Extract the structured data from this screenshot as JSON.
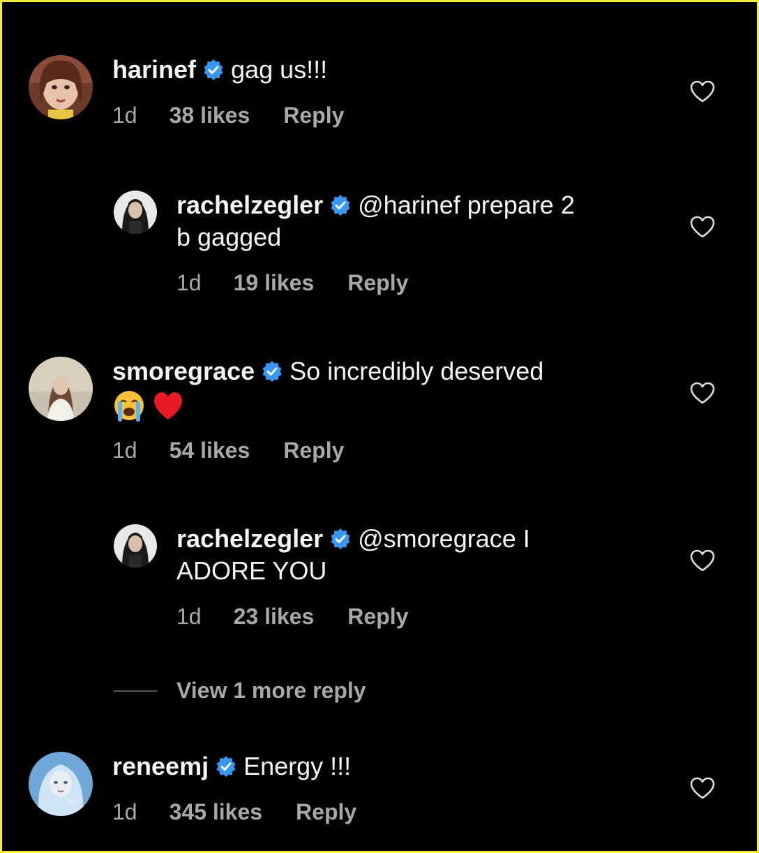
{
  "comments": [
    {
      "username": "harinef",
      "text": "gag us!!!",
      "time": "1d",
      "likes": "38 likes",
      "reply_label": "Reply",
      "avatar_icon": "avatar-harinef"
    },
    {
      "username": "rachelzegler",
      "text_line1": "@harinef prepare 2",
      "text_line2": "b gagged",
      "time": "1d",
      "likes": "19 likes",
      "reply_label": "Reply",
      "avatar_icon": "avatar-rachelzegler"
    },
    {
      "username": "smoregrace",
      "text": "So incredibly deserved",
      "emojis": [
        "loudly-crying-face-emoji",
        "red-heart-emoji"
      ],
      "time": "1d",
      "likes": "54 likes",
      "reply_label": "Reply",
      "avatar_icon": "avatar-smoregrace"
    },
    {
      "username": "rachelzegler",
      "text_line1": "@smoregrace I",
      "text_line2": "ADORE YOU",
      "time": "1d",
      "likes": "23 likes",
      "reply_label": "Reply",
      "avatar_icon": "avatar-rachelzegler"
    },
    {
      "username": "reneemj",
      "text": "Energy !!!",
      "time": "1d",
      "likes": "345 likes",
      "reply_label": "Reply",
      "avatar_icon": "avatar-reneemj"
    }
  ],
  "view_more_replies": "View 1 more reply",
  "colors": {
    "background": "#000000",
    "frame_border": "#f2ee3a",
    "text": "#f5f5f5",
    "meta_text": "#a8a8a8",
    "verified_badge": "#3897f0"
  },
  "icons": [
    "verified-badge-icon",
    "heart-icon"
  ]
}
